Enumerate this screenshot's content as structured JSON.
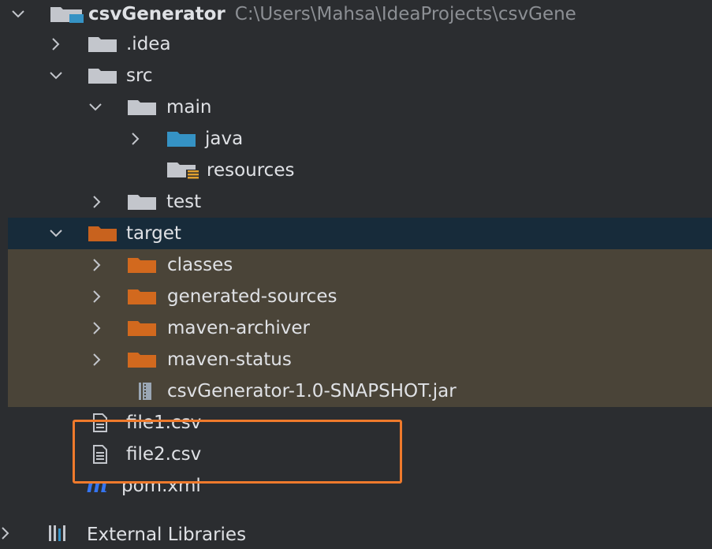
{
  "project_tree": {
    "root": {
      "name": "csvGenerator",
      "path": "C:\\Users\\Mahsa\\IdeaProjects\\csvGene"
    },
    "items": {
      "idea": "idea",
      "idea_dot": ".idea",
      "src": "src",
      "main": "main",
      "java": "java",
      "resources": "resources",
      "test": "test",
      "target": "target",
      "classes": "classes",
      "generated_sources": "generated-sources",
      "maven_archiver": "maven-archiver",
      "maven_status": "maven-status",
      "jar": "csvGenerator-1.0-SNAPSHOT.jar",
      "file1": "file1.csv",
      "file2": "file2.csv",
      "pom": "pom.xml",
      "external_libraries": "External Libraries"
    }
  },
  "colors": {
    "background": "#2b2d30",
    "selected_row": "#172b3a",
    "excluded_rows": "#4a4438",
    "highlight_border": "#ef7a2c",
    "folder_gray": "#c3c6cc",
    "folder_blue": "#3592c4",
    "folder_orange": "#d2691e",
    "maven_blue": "#3574f0"
  },
  "icons": {
    "chevron_down": "chevron-down-icon",
    "chevron_right": "chevron-right-icon",
    "folder": "folder-icon",
    "module_folder": "module-folder-icon",
    "source_folder": "source-folder-icon",
    "resources_folder": "resources-folder-icon",
    "excluded_folder": "excluded-folder-icon",
    "jar": "jar-icon",
    "text_file": "text-file-icon",
    "maven": "maven-icon",
    "libraries": "libraries-icon"
  }
}
